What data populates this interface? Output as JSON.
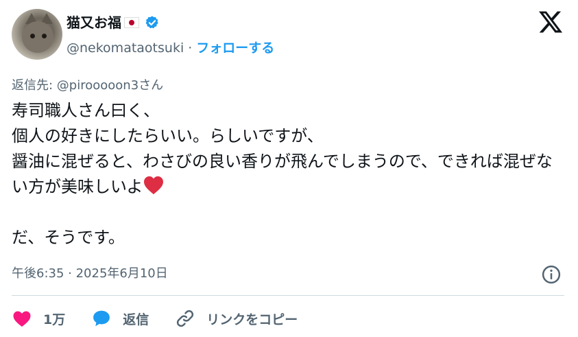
{
  "author": {
    "display_name": "猫又お福",
    "handle": "@nekomataotsuki",
    "separator": "·",
    "follow_label": "フォローする"
  },
  "reply_to": "返信先: @pirooooon3さん",
  "tweet": {
    "text_main": "寿司職人さん曰く、\n個人の好きにしたらいい。らしいですが、\n醤油に混ぜると、わさびの良い香りが飛んでしまうので、できれば混ぜない方が美味しいよ",
    "text_tail": "\n\nだ、そうです。",
    "timestamp": "午後6:35 · 2025年6月10日"
  },
  "actions": {
    "like_count": "1万",
    "reply_label": "返信",
    "copy_link_label": "リンクをコピー"
  },
  "colors": {
    "accent": "#1d9bf0",
    "like": "#f91880",
    "secondary_text": "#536471"
  },
  "icons": [
    "verified-badge-icon",
    "x-logo-icon",
    "heart-emoji-icon",
    "info-icon",
    "like-heart-icon",
    "reply-bubble-icon",
    "link-icon"
  ]
}
